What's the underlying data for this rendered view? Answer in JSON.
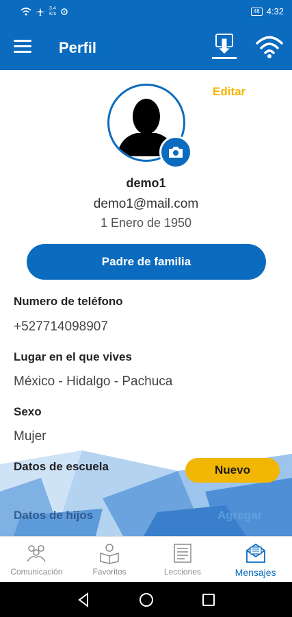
{
  "status_bar": {
    "net_speed_top": "3.4",
    "net_speed_bottom": "K/s",
    "battery": "48",
    "time": "4:32"
  },
  "app_bar": {
    "title": "Perfil"
  },
  "profile": {
    "edit_label": "Editar",
    "name": "demo1",
    "email": "demo1@mail.com",
    "birth_date": "1 Enero de 1950",
    "role_button": "Padre de familia"
  },
  "fields": {
    "phone_label": "Numero de teléfono",
    "phone_value": "+527714098907",
    "location_label": "Lugar en el que vives",
    "location_value": "México - Hidalgo - Pachuca",
    "sex_label": "Sexo",
    "sex_value": "Mujer",
    "school_label": "Datos de escuela",
    "school_new_button": "Nuevo",
    "children_label": "Datos de hijos",
    "children_add_button": "Agregar"
  },
  "bottom_nav": [
    {
      "label": "Comunicación",
      "icon": "community-icon"
    },
    {
      "label": "Favoritos",
      "icon": "reader-icon"
    },
    {
      "label": "Lecciones",
      "icon": "book-icon"
    },
    {
      "label": "Mensajes",
      "icon": "envelope-icon",
      "active": true
    }
  ],
  "colors": {
    "primary": "#0b6bbf",
    "accent": "#f2b705"
  }
}
